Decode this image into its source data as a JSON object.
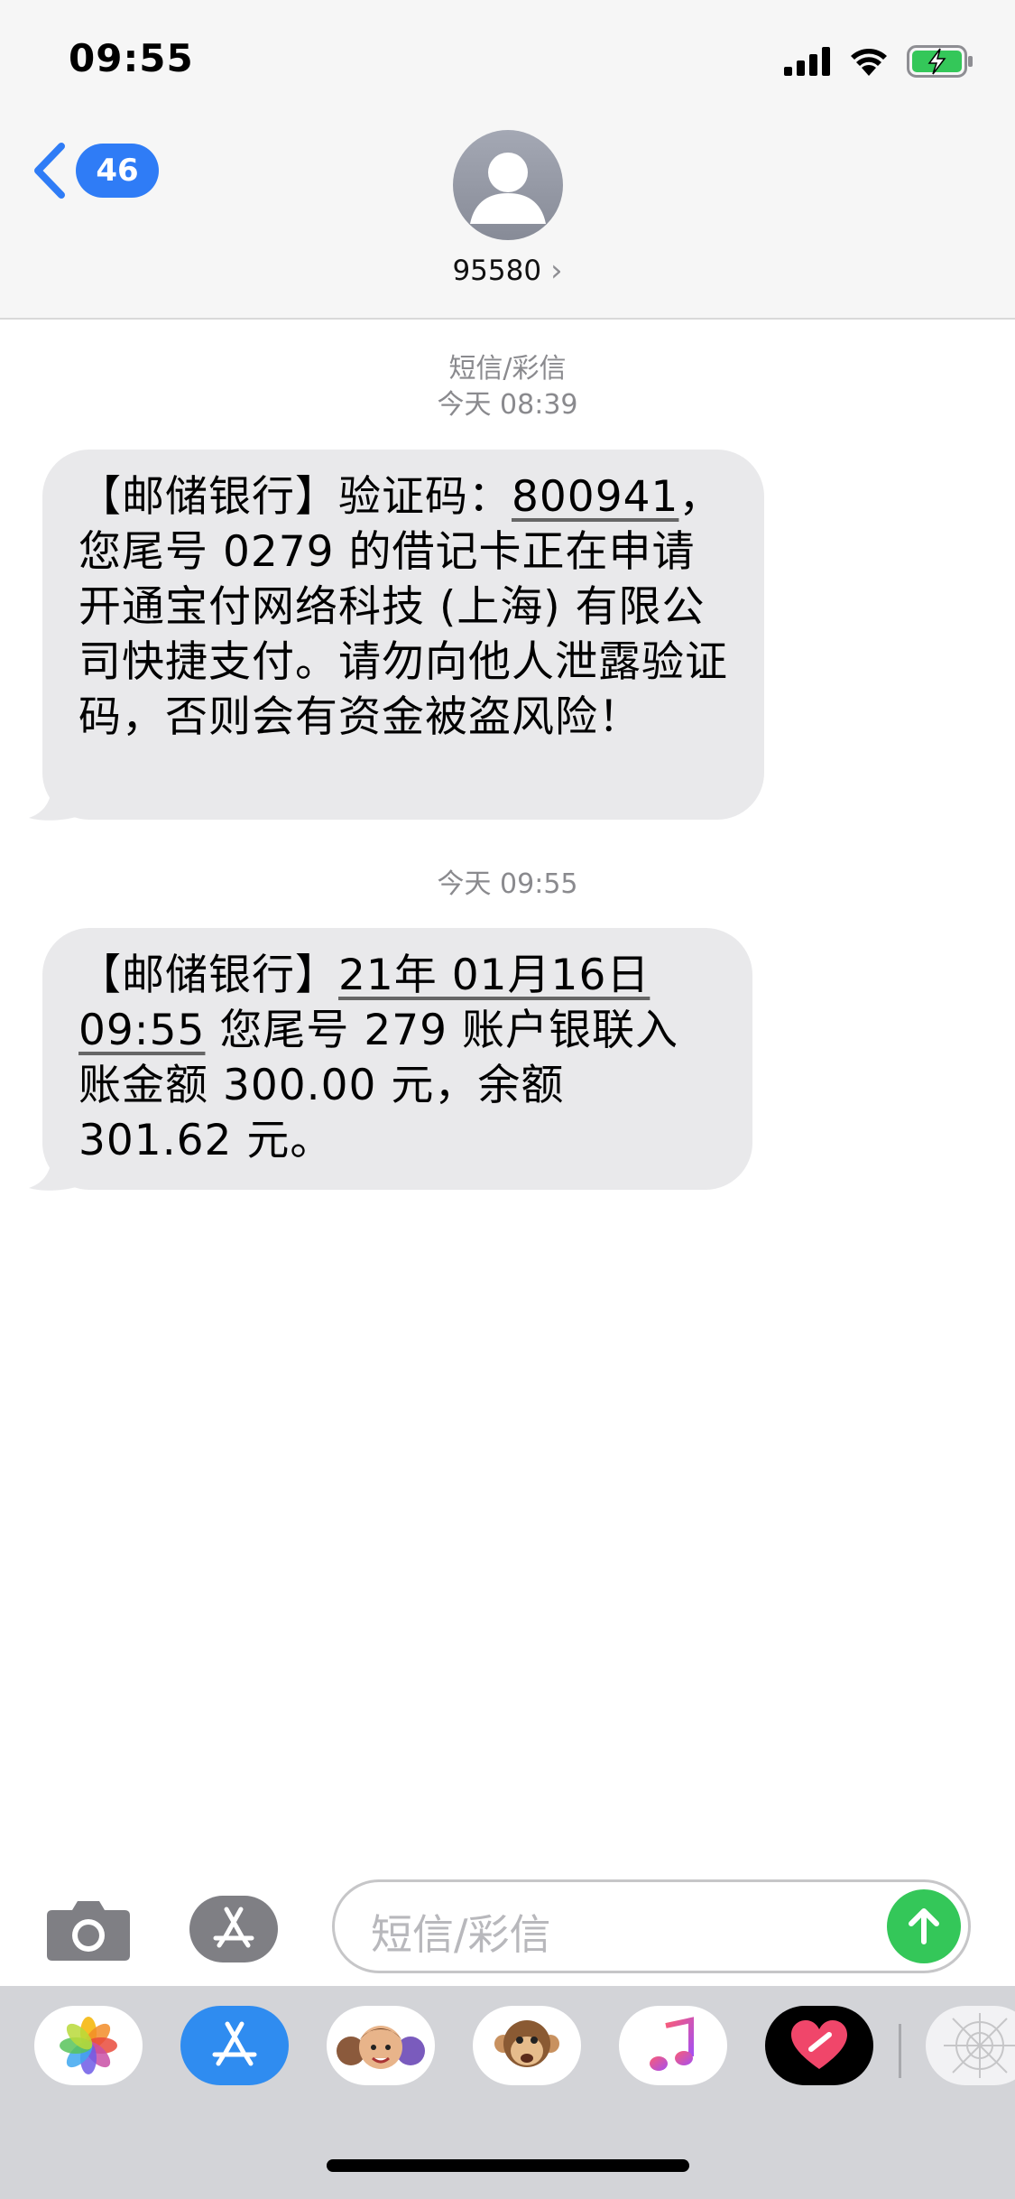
{
  "status_bar": {
    "time": "09:55"
  },
  "nav": {
    "back_count": "46",
    "contact": "95580",
    "chevron": "›"
  },
  "thread": {
    "service_label": "短信/彩信",
    "timestamp_1": "今天 08:39",
    "message_1": {
      "p1": "【邮储银行】验证码：",
      "p2": "800941",
      "p3": "，您尾号 0279 的借记卡正在申请开通宝付网络科技 (上海) 有限公司快捷支付。请勿向他人泄露验证码，否则会有资金被盗风险！"
    },
    "timestamp_2": "今天 09:55",
    "message_2": {
      "p1": "【邮储银行】",
      "p2": "21年 01月16日 09:55",
      "p3": " 您尾号 279 账户银联入账金额 300.00 元，余额 301.62 元。"
    }
  },
  "composer": {
    "placeholder": "短信/彩信"
  },
  "app_drawer": {
    "apps": [
      "photos-icon",
      "app-store-icon",
      "memoji-icon",
      "animoji-icon",
      "music-icon",
      "digital-touch-icon",
      "more-apps-icon"
    ]
  },
  "colors": {
    "accent": "#2f7cf6",
    "bubble": "#e9e9eb",
    "send": "#34c759"
  }
}
